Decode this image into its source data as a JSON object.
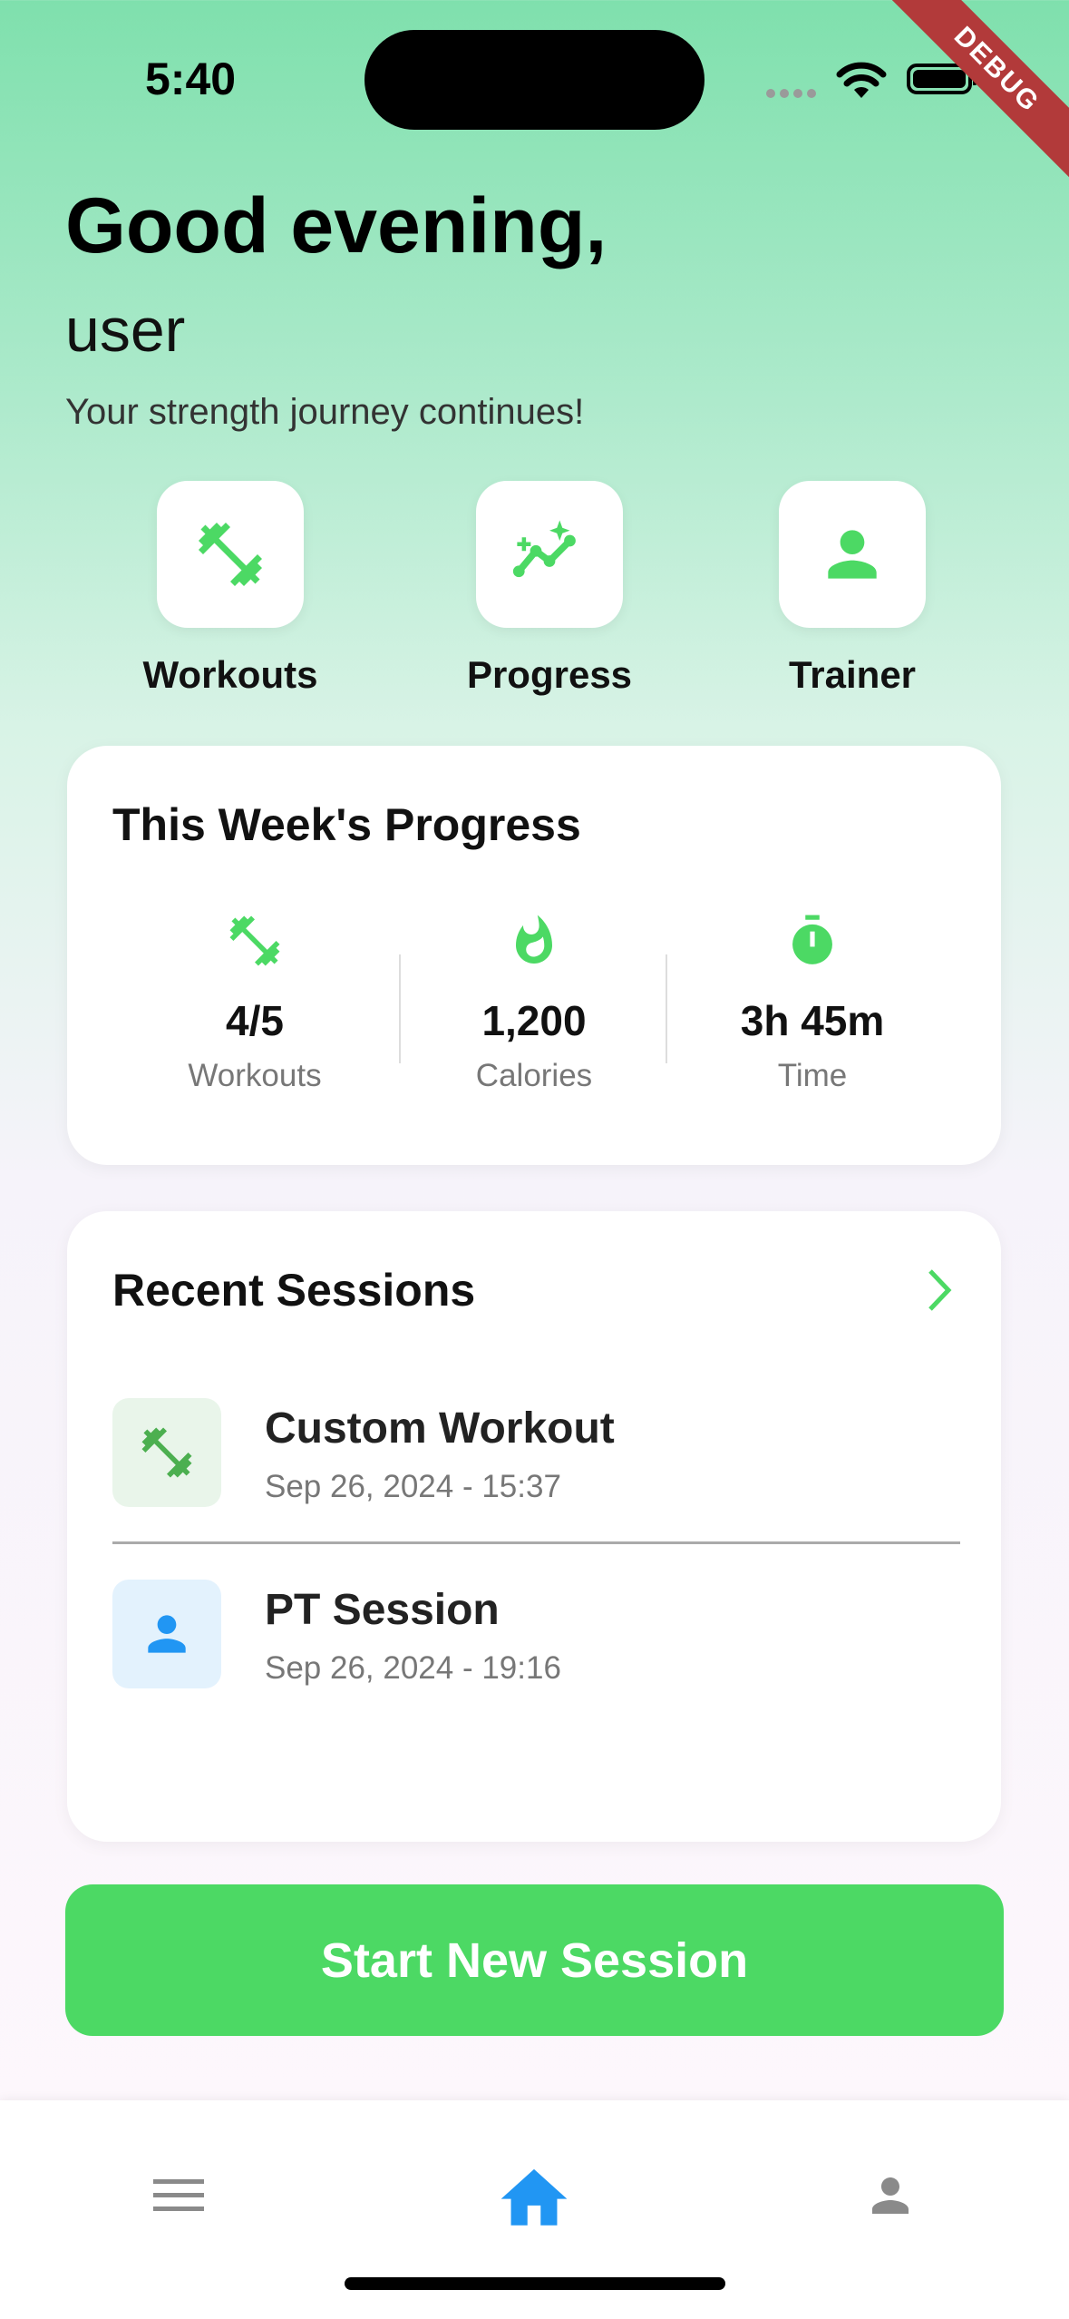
{
  "status_bar": {
    "time": "5:40"
  },
  "debug_banner": "DEBUG",
  "header": {
    "greeting": "Good evening,",
    "username": "user",
    "tagline": "Your strength journey continues!"
  },
  "quick_actions": [
    {
      "label": "Workouts",
      "icon": "dumbbell-icon"
    },
    {
      "label": "Progress",
      "icon": "trending-chart-icon"
    },
    {
      "label": "Trainer",
      "icon": "person-icon"
    }
  ],
  "weekly_progress": {
    "title": "This Week's Progress",
    "stats": [
      {
        "value": "4/5",
        "label": "Workouts",
        "icon": "dumbbell-icon"
      },
      {
        "value": "1,200",
        "label": "Calories",
        "icon": "flame-icon"
      },
      {
        "value": "3h 45m",
        "label": "Time",
        "icon": "timer-icon"
      }
    ]
  },
  "recent_sessions": {
    "title": "Recent Sessions",
    "items": [
      {
        "title": "Custom Workout",
        "time": "Sep 26, 2024 - 15:37",
        "icon": "dumbbell-icon"
      },
      {
        "title": "PT Session",
        "time": "Sep 26, 2024 - 19:16",
        "icon": "person-icon"
      }
    ]
  },
  "cta": {
    "label": "Start New Session"
  },
  "colors": {
    "accent_green": "#4cd964",
    "accent_blue": "#2196f3",
    "icon_green": "#4caf50"
  },
  "bottom_nav": [
    {
      "icon": "menu-icon",
      "active": false
    },
    {
      "icon": "home-icon",
      "active": true
    },
    {
      "icon": "profile-icon",
      "active": false
    }
  ]
}
